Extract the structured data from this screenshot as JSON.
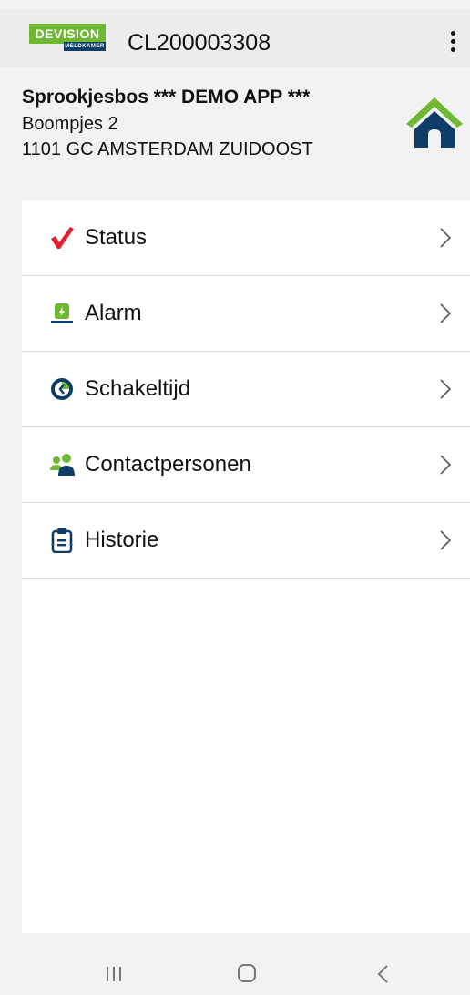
{
  "appbar": {
    "logo_text": "DEVISION",
    "logo_subtext": "MELDKAMER",
    "title": "CL200003308"
  },
  "site": {
    "name": "Sprookjesbos *** DEMO APP ***",
    "street": "Boompjes 2",
    "city": "1101 GC AMSTERDAM ZUIDOOST"
  },
  "menu": {
    "items": [
      {
        "label": "Status",
        "icon": "checkmark-icon"
      },
      {
        "label": "Alarm",
        "icon": "alarm-light-icon"
      },
      {
        "label": "Schakeltijd",
        "icon": "clock-icon"
      },
      {
        "label": "Contactpersonen",
        "icon": "people-icon"
      },
      {
        "label": "Historie",
        "icon": "clipboard-icon"
      }
    ]
  },
  "navbar": {
    "buttons": [
      "recent-apps-icon",
      "home-circle-icon",
      "back-icon"
    ]
  },
  "colors": {
    "brand_green": "#6fb832",
    "brand_navy": "#0e3e68",
    "status_red": "#e0202a"
  }
}
